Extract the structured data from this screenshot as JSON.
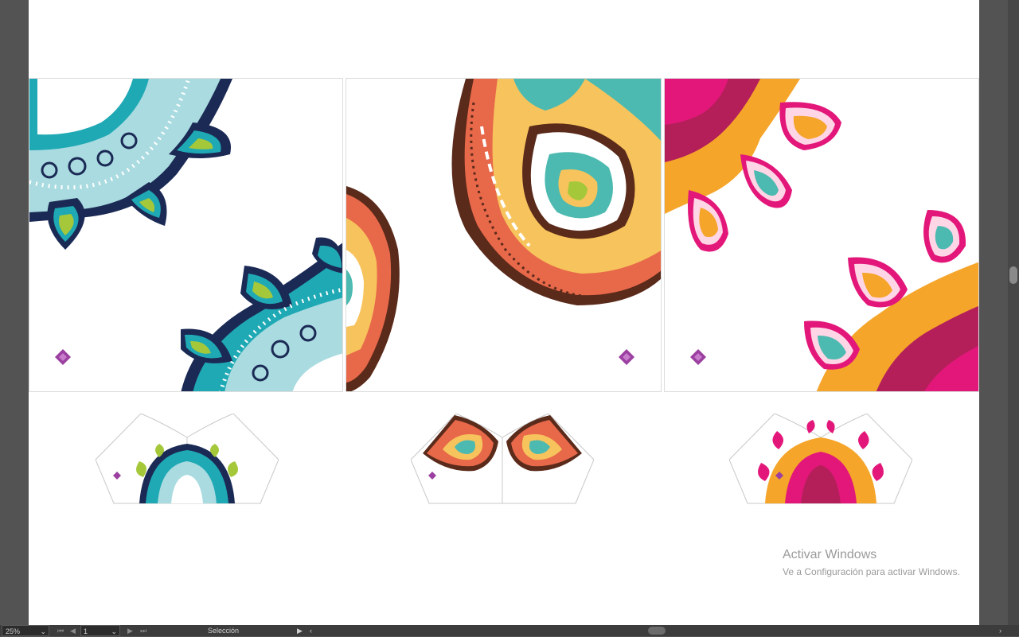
{
  "status_bar": {
    "zoom": "25%",
    "page": "1",
    "tool": "Selección"
  },
  "watermark": {
    "title": "Activar Windows",
    "subtitle": "Ve a Configuración para activar Windows."
  },
  "colors": {
    "teal": "#1fa9b4",
    "lime": "#a4c83a",
    "navy": "#1b2a55",
    "pink": "#e3177a",
    "orange": "#f5a52a",
    "brown": "#5a2a1a",
    "coral": "#e8684a",
    "purple": "#9b3fa0"
  },
  "icons": {
    "logo": "diamond-logo-icon",
    "nav_first": "first-page-icon",
    "nav_prev": "prev-page-icon",
    "nav_next": "next-page-icon",
    "nav_last": "last-page-icon",
    "dropdown": "chevron-down-icon",
    "play": "play-icon",
    "scroll_left": "scroll-left-icon",
    "scroll_right": "scroll-right-icon"
  }
}
